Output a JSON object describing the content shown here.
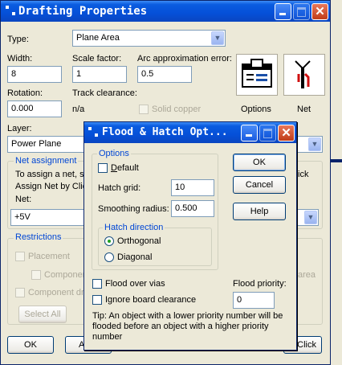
{
  "main": {
    "title": "Drafting Properties",
    "type": {
      "label": "Type:",
      "value": "Plane Area"
    },
    "width": {
      "label": "Width:",
      "value": "8"
    },
    "scale": {
      "label": "Scale factor:",
      "value": "1"
    },
    "arc": {
      "label": "Arc approximation error:",
      "value": "0.5"
    },
    "rotation": {
      "label": "Rotation:",
      "value": "0.000"
    },
    "track": {
      "label": "Track clearance:",
      "value": "n/a"
    },
    "solid_copper": "Solid copper",
    "options_label": "Options",
    "net_label": "Net",
    "layer": {
      "label": "Layer:",
      "value": "Power Plane"
    },
    "net_assignment": {
      "title": "Net assignment",
      "line1": "To assign a net, se",
      "line1_right": "ick",
      "line2": "Assign Net by Clic",
      "net_label": "Net:",
      "net_value": "+5V"
    },
    "restrictions": {
      "title": "Restrictions",
      "placement": "Placement",
      "component": "Componen",
      "area": "area",
      "component_drill": "Component dri",
      "select_all": "Select All"
    },
    "ok": "OK",
    "a_stub": "A",
    "click_stub": "Click"
  },
  "dialog": {
    "title": "Flood & Hatch Opt...",
    "options_group": "Options",
    "default_label": "Default",
    "hatch_grid": {
      "label": "Hatch grid:",
      "value": "10"
    },
    "smoothing": {
      "label": "Smoothing radius:",
      "value": "0.500"
    },
    "hatch_direction": "Hatch direction",
    "orthogonal": "Orthogonal",
    "diagonal": "Diagonal",
    "ok": "OK",
    "cancel": "Cancel",
    "help": "Help",
    "flood_over_vias": "Flood over vias",
    "ignore_board_clearance": "Ignore board clearance",
    "flood_priority": {
      "label": "Flood priority:",
      "value": "0"
    },
    "tip": "Tip: An object with a lower priority number will be flooded before an object with a higher priority number"
  },
  "colors": {
    "titlebar": "#0550d8",
    "face": "#ece9d8",
    "accent": "#0046d5",
    "desktop": "#5a86c8"
  }
}
